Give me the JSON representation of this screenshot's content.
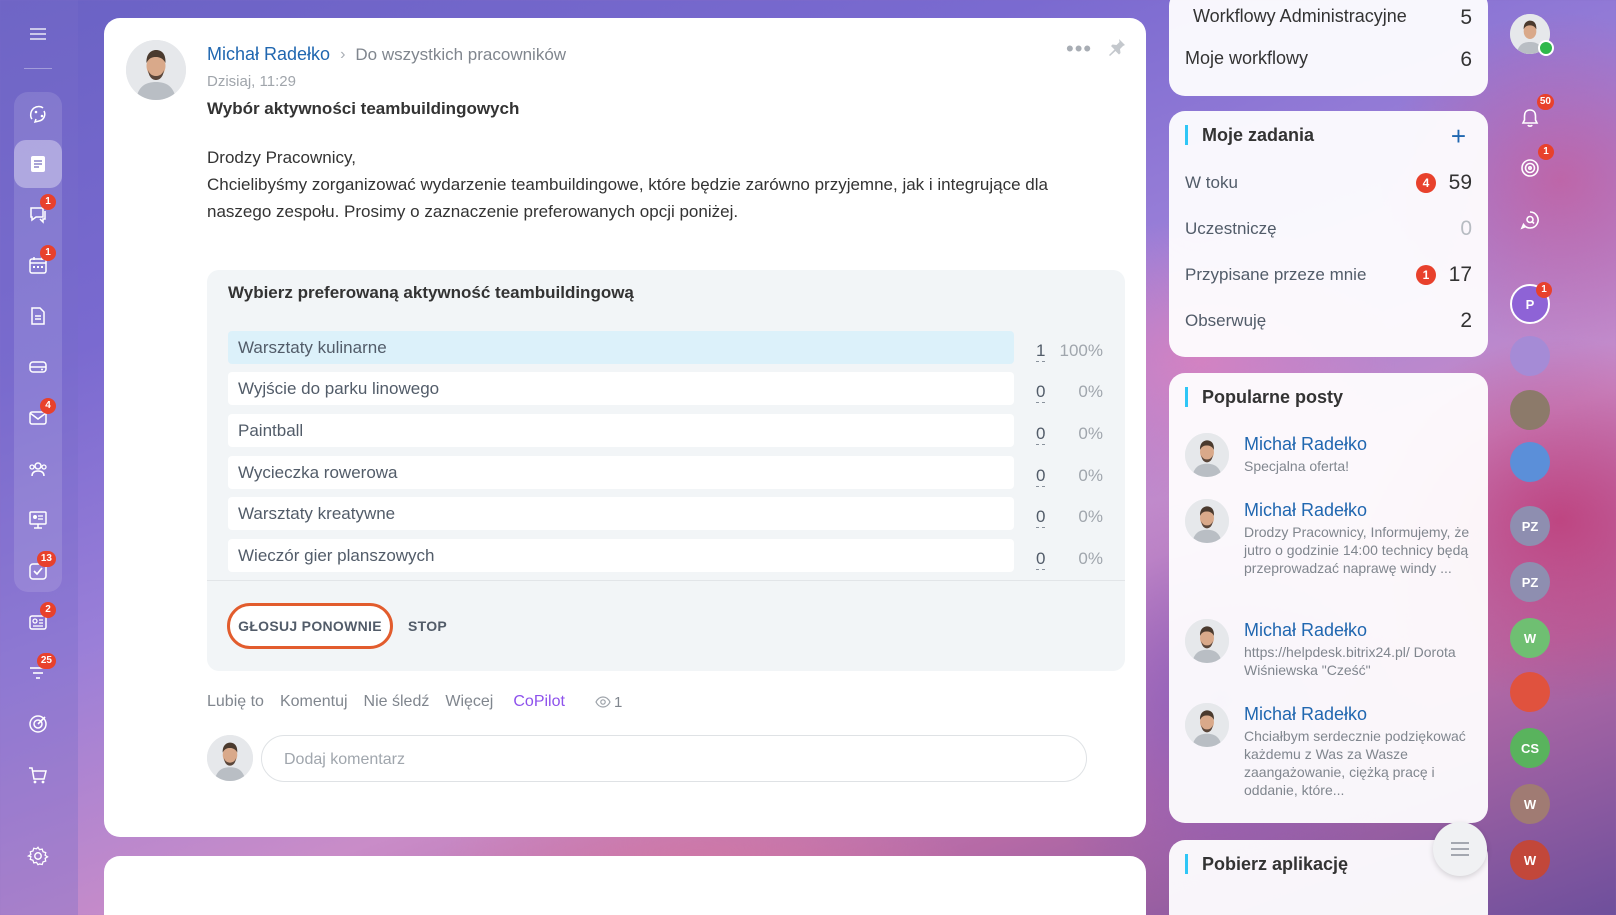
{
  "left_rail": {
    "items": [
      {
        "icon": "sparkle-chat-icon",
        "badge": ""
      },
      {
        "icon": "news-feed-icon",
        "badge": "",
        "active": true
      },
      {
        "icon": "messenger-icon",
        "badge": "1"
      },
      {
        "icon": "calendar-icon",
        "badge": "1"
      },
      {
        "icon": "document-icon",
        "badge": ""
      },
      {
        "icon": "drive-icon",
        "badge": ""
      },
      {
        "icon": "mail-icon",
        "badge": "4"
      },
      {
        "icon": "groups-icon",
        "badge": ""
      },
      {
        "icon": "presentation-icon",
        "badge": ""
      },
      {
        "icon": "tasks-icon",
        "badge": "13"
      },
      {
        "icon": "crm-icon",
        "badge": "2"
      },
      {
        "icon": "filter-funnel-icon",
        "badge": "25"
      },
      {
        "icon": "target-icon",
        "badge": ""
      },
      {
        "icon": "cart-icon",
        "badge": ""
      }
    ]
  },
  "post": {
    "author": "Michał Radełko",
    "audience": "Do wszystkich pracowników",
    "date": "Dzisiaj, 11:29",
    "title": "Wybór aktywności teambuildingowych",
    "body_greeting": "Drodzy Pracownicy,",
    "body_text": "Chcielibyśmy zorganizować wydarzenie teambuildingowe, które będzie zarówno przyjemne, jak i integrujące dla naszego zespołu. Prosimy o zaznaczenie preferowanych opcji poniżej.",
    "poll": {
      "question": "Wybierz preferowaną aktywność teambuildingową",
      "options": [
        {
          "label": "Warsztaty kulinarne",
          "votes": "1",
          "percent": "100%",
          "voted": true
        },
        {
          "label": "Wyjście do parku linowego",
          "votes": "0",
          "percent": "0%"
        },
        {
          "label": "Paintball",
          "votes": "0",
          "percent": "0%"
        },
        {
          "label": "Wycieczka rowerowa",
          "votes": "0",
          "percent": "0%"
        },
        {
          "label": "Warsztaty kreatywne",
          "votes": "0",
          "percent": "0%"
        },
        {
          "label": "Wieczór gier planszowych",
          "votes": "0",
          "percent": "0%"
        }
      ],
      "vote_again_label": "GŁOSUJ PONOWNIE",
      "stop_label": "STOP"
    },
    "actions": {
      "like": "Lubię to",
      "comment": "Komentuj",
      "unfollow": "Nie śledź",
      "more": "Więcej",
      "copilot": "CoPilot",
      "views": "1"
    },
    "comment_placeholder": "Dodaj komentarz"
  },
  "workflow_widget": {
    "rows": [
      {
        "label": "Workflowy Administracyjne",
        "count": "5"
      },
      {
        "label": "Moje workflowy",
        "count": "6"
      }
    ]
  },
  "tasks_widget": {
    "title": "Moje zadania",
    "add_label": "+",
    "rows": [
      {
        "label": "W toku",
        "badge": "4",
        "count": "59"
      },
      {
        "label": "Uczestniczę",
        "badge": "",
        "count": "0"
      },
      {
        "label": "Przypisane przeze mnie",
        "badge": "1",
        "count": "17"
      },
      {
        "label": "Obserwuję",
        "badge": "",
        "count": "2"
      }
    ]
  },
  "popular_widget": {
    "title": "Popularne posty",
    "items": [
      {
        "author": "Michał Radełko",
        "text": "Specjalna oferta!"
      },
      {
        "author": "Michał Radełko",
        "text": "Drodzy Pracownicy, Informujemy, że jutro o godzinie 14:00 technicy będą przeprowadzać naprawę windy ..."
      },
      {
        "author": "Michał Radełko",
        "text": "https://helpdesk.bitrix24.pl/ Dorota Wiśniewska \"Cześć\""
      },
      {
        "author": "Michał Radełko",
        "text": "Chciałbym serdecznie podziękować każdemu z Was za Wasze zaangażowanie, ciężką pracę i oddanie, które..."
      }
    ]
  },
  "apps_widget": {
    "title": "Pobierz aplikację"
  },
  "right_rail": {
    "notifications_badge": "50",
    "target_badge": "1",
    "chat_p_badge": "1",
    "chats": [
      {
        "initials": "P",
        "color": "#8e63d6"
      },
      {
        "initials": "",
        "color": "#a58bd6"
      },
      {
        "initials": "",
        "color": "#8c7a6a"
      },
      {
        "initials": "",
        "color": "#5b8fd9"
      },
      {
        "initials": "PZ",
        "color": "#8e8eb0"
      },
      {
        "initials": "PZ",
        "color": "#8e8eb0"
      },
      {
        "initials": "W",
        "color": "#6fbf72"
      },
      {
        "initials": "",
        "color": "#e0523e"
      },
      {
        "initials": "CS",
        "color": "#59b35d"
      },
      {
        "initials": "W",
        "color": "#a07b73"
      },
      {
        "initials": "W",
        "color": "#c2473a"
      }
    ]
  },
  "colors": {
    "accent": "#2067b0",
    "highlight_border": "#e25c2d",
    "badge": "#e8412c",
    "copilot": "#8e52ec"
  }
}
